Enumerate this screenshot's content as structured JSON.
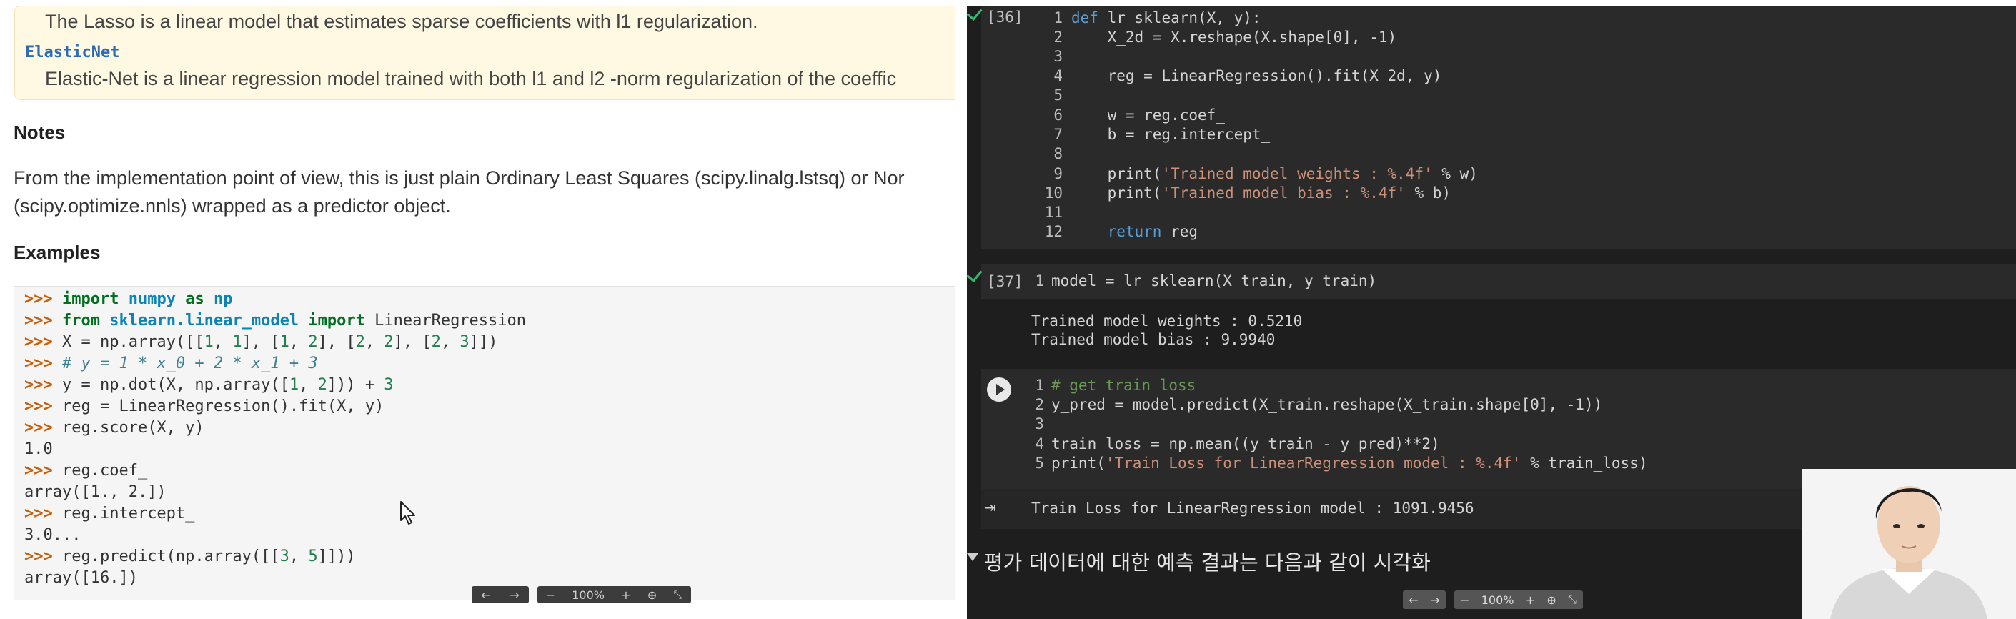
{
  "docs": {
    "see_also": {
      "lasso_desc": "The Lasso is a linear model that estimates sparse coefficients with l1 regularization.",
      "elasticnet_link": "ElasticNet",
      "elasticnet_desc": "Elastic-Net is a linear regression model trained with both l1 and l2 -norm regularization of the coeffic"
    },
    "notes_heading": "Notes",
    "notes_line1": "From the implementation point of view, this is just plain Ordinary Least Squares (scipy.linalg.lstsq) or Nor",
    "notes_line2": "(scipy.optimize.nnls) wrapped as a predictor object.",
    "examples_heading": "Examples",
    "code": [
      ">>> import numpy as np",
      ">>> from sklearn.linear_model import LinearRegression",
      ">>> X = np.array([[1, 1], [1, 2], [2, 2], [2, 3]])",
      ">>> # y = 1 * x_0 + 2 * x_1 + 3",
      ">>> y = np.dot(X, np.array([1, 2])) + 3",
      ">>> reg = LinearRegression().fit(X, y)",
      ">>> reg.score(X, y)",
      "1.0",
      ">>> reg.coef_",
      "array([1., 2.])",
      ">>> reg.intercept_",
      "3.0...",
      ">>> reg.predict(np.array([[3, 5]]))",
      "array([16.])"
    ],
    "toolbar": {
      "back": "←",
      "forward": "→",
      "zoom_out": "−",
      "zoom": "100%",
      "zoom_in": "+",
      "search": "⊕",
      "fit": "⤡"
    }
  },
  "notebook": {
    "cell36": {
      "count": "[36]",
      "lines": [
        "def lr_sklearn(X, y):",
        "    X_2d = X.reshape(X.shape[0], -1)",
        "",
        "    reg = LinearRegression().fit(X_2d, y)",
        "",
        "    w = reg.coef_",
        "    b = reg.intercept_",
        "",
        "    print('Trained model weights : %.4f' % w)",
        "    print('Trained model bias : %.4f' % b)",
        "",
        "    return reg"
      ]
    },
    "cell37": {
      "count": "[37]",
      "code": "model = lr_sklearn(X_train, y_train)",
      "output": [
        "Trained model weights : 0.5210",
        "Trained model bias : 9.9940"
      ]
    },
    "cell_running": {
      "lines": [
        "# get train loss",
        "y_pred = model.predict(X_train.reshape(X_train.shape[0], -1))",
        "",
        "train_loss = np.mean((y_train - y_pred)**2)",
        "print('Train Loss for LinearRegression model : %.4f' % train_loss)"
      ],
      "output": "Train Loss for LinearRegression model : 1091.9456"
    },
    "section_heading": "평가 데이터에 대한 예측 결과는 다음과 같이 시각화",
    "toolbar": {
      "back": "←",
      "forward": "→",
      "zoom_out": "−",
      "zoom": "100%",
      "zoom_in": "+",
      "search": "⊕",
      "fit": "⤡"
    }
  },
  "colors": {
    "accent_green": "#35b86b",
    "notebook_bg": "#1e1e1e",
    "doc_note_bg": "#fff8e2"
  }
}
